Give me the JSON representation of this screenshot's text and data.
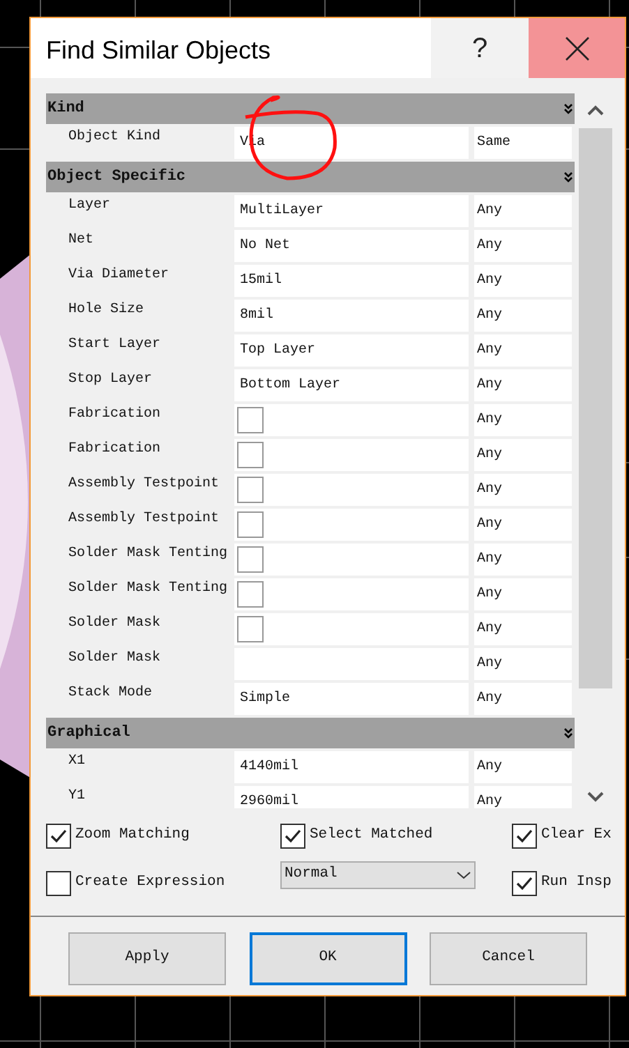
{
  "window": {
    "title": "Find Similar Objects",
    "help": "?"
  },
  "sections": [
    {
      "title": "Kind",
      "rows": [
        {
          "label": "Object Kind",
          "kind": "text",
          "value": "Via",
          "match": "Same"
        }
      ]
    },
    {
      "title": "Object Specific",
      "rows": [
        {
          "label": "Layer",
          "kind": "text",
          "value": "MultiLayer",
          "match": "Any"
        },
        {
          "label": "Net",
          "kind": "text",
          "value": "No Net",
          "match": "Any"
        },
        {
          "label": "Via Diameter",
          "kind": "text",
          "value": "15mil",
          "match": "Any"
        },
        {
          "label": "Hole Size",
          "kind": "text",
          "value": "8mil",
          "match": "Any"
        },
        {
          "label": "Start Layer",
          "kind": "text",
          "value": "Top Layer",
          "match": "Any"
        },
        {
          "label": "Stop Layer",
          "kind": "text",
          "value": "Bottom Layer",
          "match": "Any"
        },
        {
          "label": "Fabrication",
          "kind": "checkbox",
          "checked": false,
          "match": "Any"
        },
        {
          "label": "Fabrication",
          "kind": "checkbox",
          "checked": false,
          "match": "Any"
        },
        {
          "label": "Assembly Testpoint",
          "kind": "checkbox",
          "checked": false,
          "match": "Any"
        },
        {
          "label": "Assembly Testpoint",
          "kind": "checkbox",
          "checked": false,
          "match": "Any"
        },
        {
          "label": "Solder Mask Tenting",
          "kind": "checkbox",
          "checked": false,
          "match": "Any"
        },
        {
          "label": "Solder Mask Tenting",
          "kind": "checkbox",
          "checked": false,
          "match": "Any"
        },
        {
          "label": "Solder Mask",
          "kind": "checkbox",
          "checked": false,
          "match": "Any"
        },
        {
          "label": "Solder Mask",
          "kind": "empty",
          "match": "Any"
        },
        {
          "label": "Stack Mode",
          "kind": "text",
          "value": "Simple",
          "match": "Any"
        }
      ]
    },
    {
      "title": "Graphical",
      "rows": [
        {
          "label": "X1",
          "kind": "text",
          "value": "4140mil",
          "match": "Any"
        },
        {
          "label": "Y1",
          "kind": "text",
          "value": "2960mil",
          "match": "Any"
        }
      ]
    }
  ],
  "options": [
    {
      "kind": "checkbox",
      "label": "Zoom Matching",
      "checked": true
    },
    {
      "kind": "checkbox",
      "label": "Select Matched",
      "checked": true
    },
    {
      "kind": "checkbox",
      "label": "Clear Ex",
      "checked": true
    },
    {
      "kind": "checkbox",
      "label": "Create Expression",
      "checked": false
    },
    {
      "kind": "select",
      "value": "Normal"
    },
    {
      "kind": "checkbox",
      "label": "Run Insp",
      "checked": true
    }
  ],
  "buttons": [
    {
      "label": "Apply",
      "focused": false
    },
    {
      "label": "OK",
      "focused": true
    },
    {
      "label": "Cancel",
      "focused": false
    }
  ]
}
